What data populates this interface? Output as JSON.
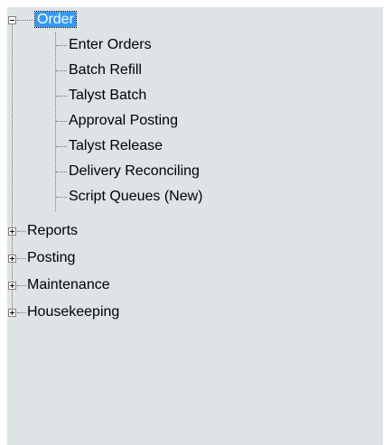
{
  "tree": {
    "root": {
      "label": "Order",
      "expanded": true,
      "children": [
        {
          "label": "Enter Orders"
        },
        {
          "label": "Batch Refill"
        },
        {
          "label": "Talyst Batch"
        },
        {
          "label": "Approval Posting"
        },
        {
          "label": "Talyst Release"
        },
        {
          "label": "Delivery Reconciling"
        },
        {
          "label": "Script Queues (New)"
        }
      ]
    },
    "siblings": [
      {
        "label": "Reports",
        "expanded": false
      },
      {
        "label": "Posting",
        "expanded": false
      },
      {
        "label": "Maintenance",
        "expanded": false
      },
      {
        "label": "Housekeeping",
        "expanded": false
      }
    ]
  },
  "colors": {
    "panel_bg": "#dee3e6",
    "selection_bg": "#3399ff",
    "selection_text": "#ffffff"
  },
  "icons": {
    "expanded_toggle": "minus-box-icon",
    "collapsed_toggle": "plus-box-icon"
  }
}
